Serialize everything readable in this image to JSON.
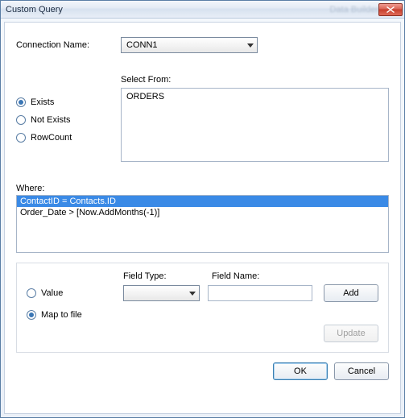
{
  "window": {
    "title": "Custom Query",
    "ghost_title": "Data Builder"
  },
  "connection": {
    "label": "Connection Name:",
    "value": "CONN1"
  },
  "mode": {
    "options": [
      {
        "label": "Exists",
        "checked": true
      },
      {
        "label": "Not Exists",
        "checked": false
      },
      {
        "label": "RowCount",
        "checked": false
      }
    ]
  },
  "select_from": {
    "label": "Select From:",
    "value": "ORDERS"
  },
  "where": {
    "label": "Where:",
    "items": [
      {
        "text": "ContactID = Contacts.ID",
        "selected": true
      },
      {
        "text": "Order_Date > [Now.AddMonths(-1)]",
        "selected": false
      }
    ]
  },
  "map_group": {
    "field_type_label": "Field Type:",
    "field_name_label": "Field Name:",
    "options": [
      {
        "label": "Value",
        "checked": false
      },
      {
        "label": "Map to file",
        "checked": true
      }
    ],
    "field_type_value": "",
    "field_name_value": "",
    "add_label": "Add",
    "update_label": "Update"
  },
  "footer": {
    "ok": "OK",
    "cancel": "Cancel"
  }
}
